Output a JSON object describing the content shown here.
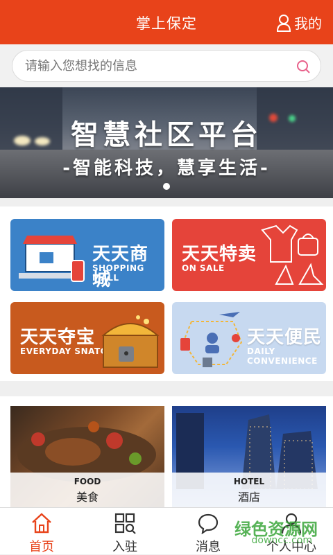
{
  "header": {
    "title": "掌上保定",
    "mine_label": "我的"
  },
  "search": {
    "placeholder": "请输入您想找的信息"
  },
  "banner": {
    "title": "智慧社区平台",
    "subtitle": "-智能科技，慧享生活-"
  },
  "cards": [
    {
      "cn": "天天商城",
      "en": "SHOPPING MALL",
      "color": "#3b82c8"
    },
    {
      "cn": "天天特卖",
      "en": "ON SALE",
      "color": "#e5443a"
    },
    {
      "cn": "天天夺宝",
      "en": "EVERYDAY SNATCH",
      "color": "#c85a1e"
    },
    {
      "cn": "天天便民",
      "en": "DAILY CONVENIENCE",
      "color": "#c7d9f0"
    }
  ],
  "features": [
    {
      "en": "FOOD",
      "cn": "美食"
    },
    {
      "en": "HOTEL",
      "cn": "酒店"
    }
  ],
  "tabs": [
    {
      "label": "首页",
      "active": true
    },
    {
      "label": "入驻"
    },
    {
      "label": "消息"
    },
    {
      "label": "个人中心"
    }
  ],
  "watermark": {
    "text": "绿色资源网",
    "url": "downcc.com"
  },
  "colors": {
    "brand": "#e8431a"
  }
}
